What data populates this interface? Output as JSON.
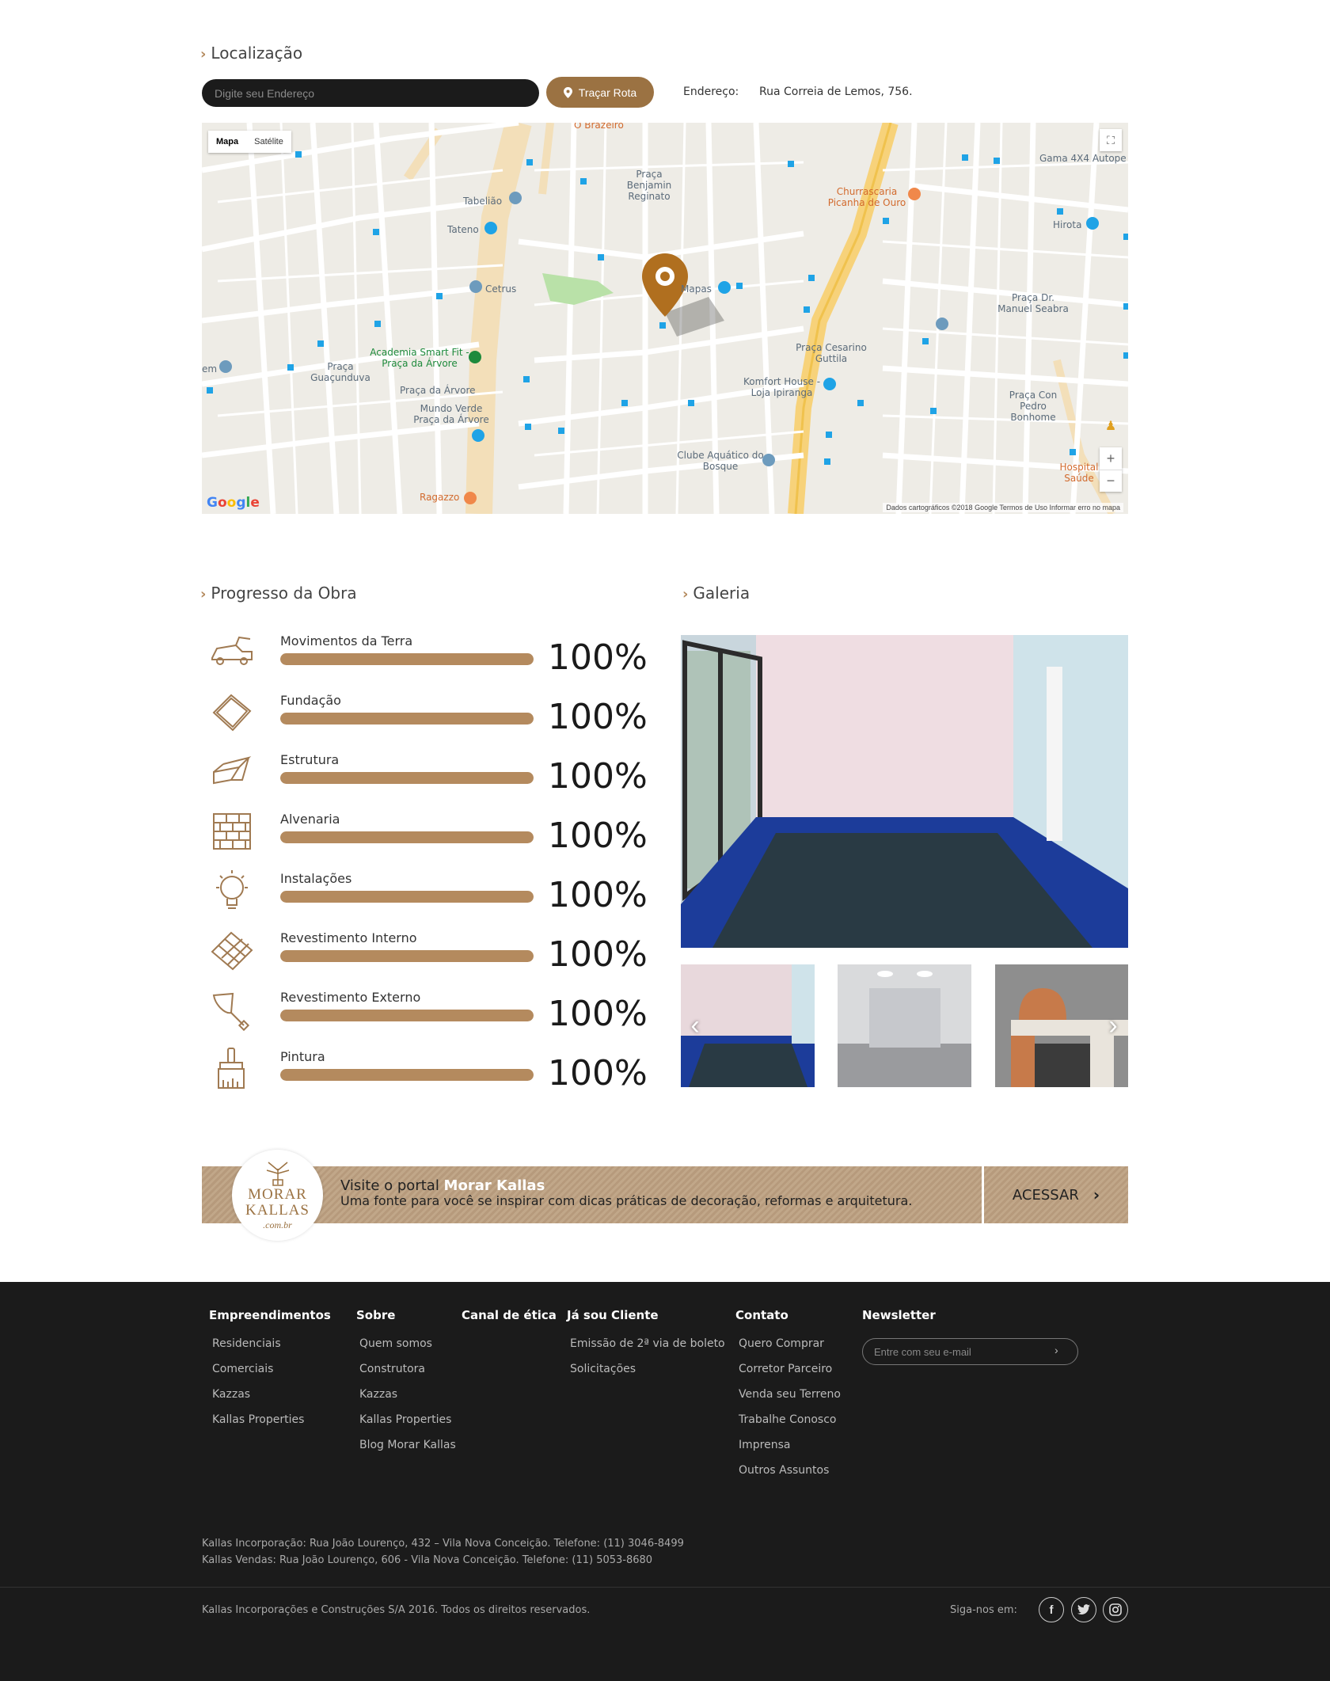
{
  "location": {
    "title": "Localização",
    "input_placeholder": "Digite seu Endereço",
    "route_button": "Traçar Rota",
    "address_label": "Endereço:",
    "address_value": "Rua Correia de Lemos, 756."
  },
  "map": {
    "type_map": "Mapa",
    "type_satellite": "Satélite",
    "labels": {
      "tabeliao": "Tabelião",
      "tateno": "Tateno",
      "cetrus": "Cetrus",
      "mapas": "Mapas",
      "praca_benjamin": "Praça Benjamin Reginato",
      "churrascaria": "Churrascaria Picanha de Ouro",
      "gama": "Gama 4X4 Autope",
      "hirota": "Hirota",
      "academia": "Academia Smart Fit - Praça da Árvore",
      "praca_guacunduva": "Praça Guaçunduva",
      "praca_arvore": "Praça da Árvore",
      "mundo_verde": "Mundo Verde Praça da Árvore",
      "praca_cesarino": "Praça Cesarino Guttila",
      "komfort": "Komfort House - Loja Ipiranga",
      "praca_manuel": "Praça Dr. Manuel Seabra",
      "praca_pedro": "Praça Con Pedro Bonhome",
      "clube": "Clube Aquático do Bosque",
      "ragazzo": "Ragazzo",
      "hospital": "Hospital Saúde",
      "o_brazeiro": "O Brazeiro",
      "em": "em"
    },
    "attribution": "Dados cartográficos ©2018 Google   Termos de Uso   Informar erro no mapa",
    "google": "Google"
  },
  "progress": {
    "title": "Progresso da Obra",
    "items": [
      {
        "name": "Movimentos da Terra",
        "value": 100,
        "label": "100%",
        "icon": "truck-icon"
      },
      {
        "name": "Fundação",
        "value": 100,
        "label": "100%",
        "icon": "foundation-icon"
      },
      {
        "name": "Estrutura",
        "value": 100,
        "label": "100%",
        "icon": "structure-icon"
      },
      {
        "name": "Alvenaria",
        "value": 100,
        "label": "100%",
        "icon": "brick-wall-icon"
      },
      {
        "name": "Instalações",
        "value": 100,
        "label": "100%",
        "icon": "lightbulb-icon"
      },
      {
        "name": "Revestimento Interno",
        "value": 100,
        "label": "100%",
        "icon": "tiles-icon"
      },
      {
        "name": "Revestimento Externo",
        "value": 100,
        "label": "100%",
        "icon": "trowel-icon"
      },
      {
        "name": "Pintura",
        "value": 100,
        "label": "100%",
        "icon": "paint-brush-icon"
      }
    ]
  },
  "gallery": {
    "title": "Galeria"
  },
  "banner": {
    "logo_line1": "MORAR",
    "logo_line2": "KALLAS",
    "logo_line3": ".com.br",
    "line1_prefix": "Visite o portal ",
    "line1_brand": "Morar Kallas",
    "line2": "Uma fonte para você se inspirar com dicas práticas de decoração, reformas e arquitetura.",
    "button": "ACESSAR"
  },
  "footer": {
    "columns": {
      "empreendimentos": {
        "title": "Empreendimentos",
        "links": [
          "Residenciais",
          "Comerciais",
          "Kazzas",
          "Kallas Properties"
        ]
      },
      "sobre": {
        "title": "Sobre",
        "links": [
          "Quem somos",
          "Construtora",
          "Kazzas",
          "Kallas Properties",
          "Blog Morar Kallas"
        ]
      },
      "etica": {
        "title": "Canal de ética",
        "links": []
      },
      "cliente": {
        "title": "Já sou Cliente",
        "links": [
          "Emissão de 2ª via de boleto",
          "Solicitações"
        ]
      },
      "contato": {
        "title": "Contato",
        "links": [
          "Quero Comprar",
          "Corretor Parceiro",
          "Venda seu Terreno",
          "Trabalhe Conosco",
          "Imprensa",
          "Outros Assuntos"
        ]
      },
      "newsletter": {
        "title": "Newsletter",
        "placeholder": "Entre com seu e-mail"
      }
    },
    "address1": "Kallas Incorporação: Rua João Lourenço, 432 – Vila Nova Conceição. Telefone: (11) 3046-8499",
    "address2": "Kallas Vendas: Rua João Lourenço, 606 - Vila Nova Conceição. Telefone: (11) 5053-8680",
    "copyright": "Kallas Incorporações e Construções S/A 2016. Todos os direitos reservados.",
    "follow": "Siga-nos em:"
  },
  "colors": {
    "accent": "#9b7242",
    "bar": "#b48a5e",
    "footer_bg": "#1b1b1b"
  }
}
